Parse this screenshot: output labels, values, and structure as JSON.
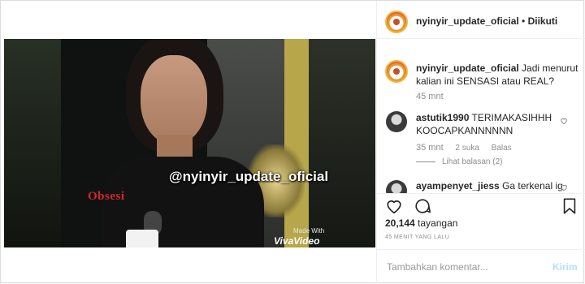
{
  "post": {
    "author": "nyinyir_update_oficial",
    "separator": "•",
    "follow_status": "Diikuti",
    "caption": "Jadi menurut kalian ini SENSASI atau REAL?",
    "caption_time": "45 mnt"
  },
  "video": {
    "watermark": "@nyinyir_update_oficial",
    "logo_text": "Obsesi",
    "made_with": "Made With",
    "app_name": "VivaVideo"
  },
  "comments": [
    {
      "user": "astutik1990",
      "text": "TERIMAKASIHHH KOOCAPKANNNNNN",
      "time": "35 mnt",
      "likes": "2 suka",
      "reply": "Balas",
      "view_replies": "Lihat balasan (2)"
    },
    {
      "user": "ayampenyet_jiess",
      "text": "Ga terkenal ig"
    }
  ],
  "stats": {
    "views_count": "20,144",
    "views_label": "tayangan",
    "posted_ago": "45 MENIT YANG LALU"
  },
  "composer": {
    "placeholder": "Tambahkan komentar...",
    "post_label": "Kirim"
  },
  "icons": [
    "heart-icon",
    "comment-icon",
    "bookmark-icon"
  ],
  "colors": {
    "post_button_disabled": "#b2dffc",
    "muted_text": "#8e8e8e"
  }
}
